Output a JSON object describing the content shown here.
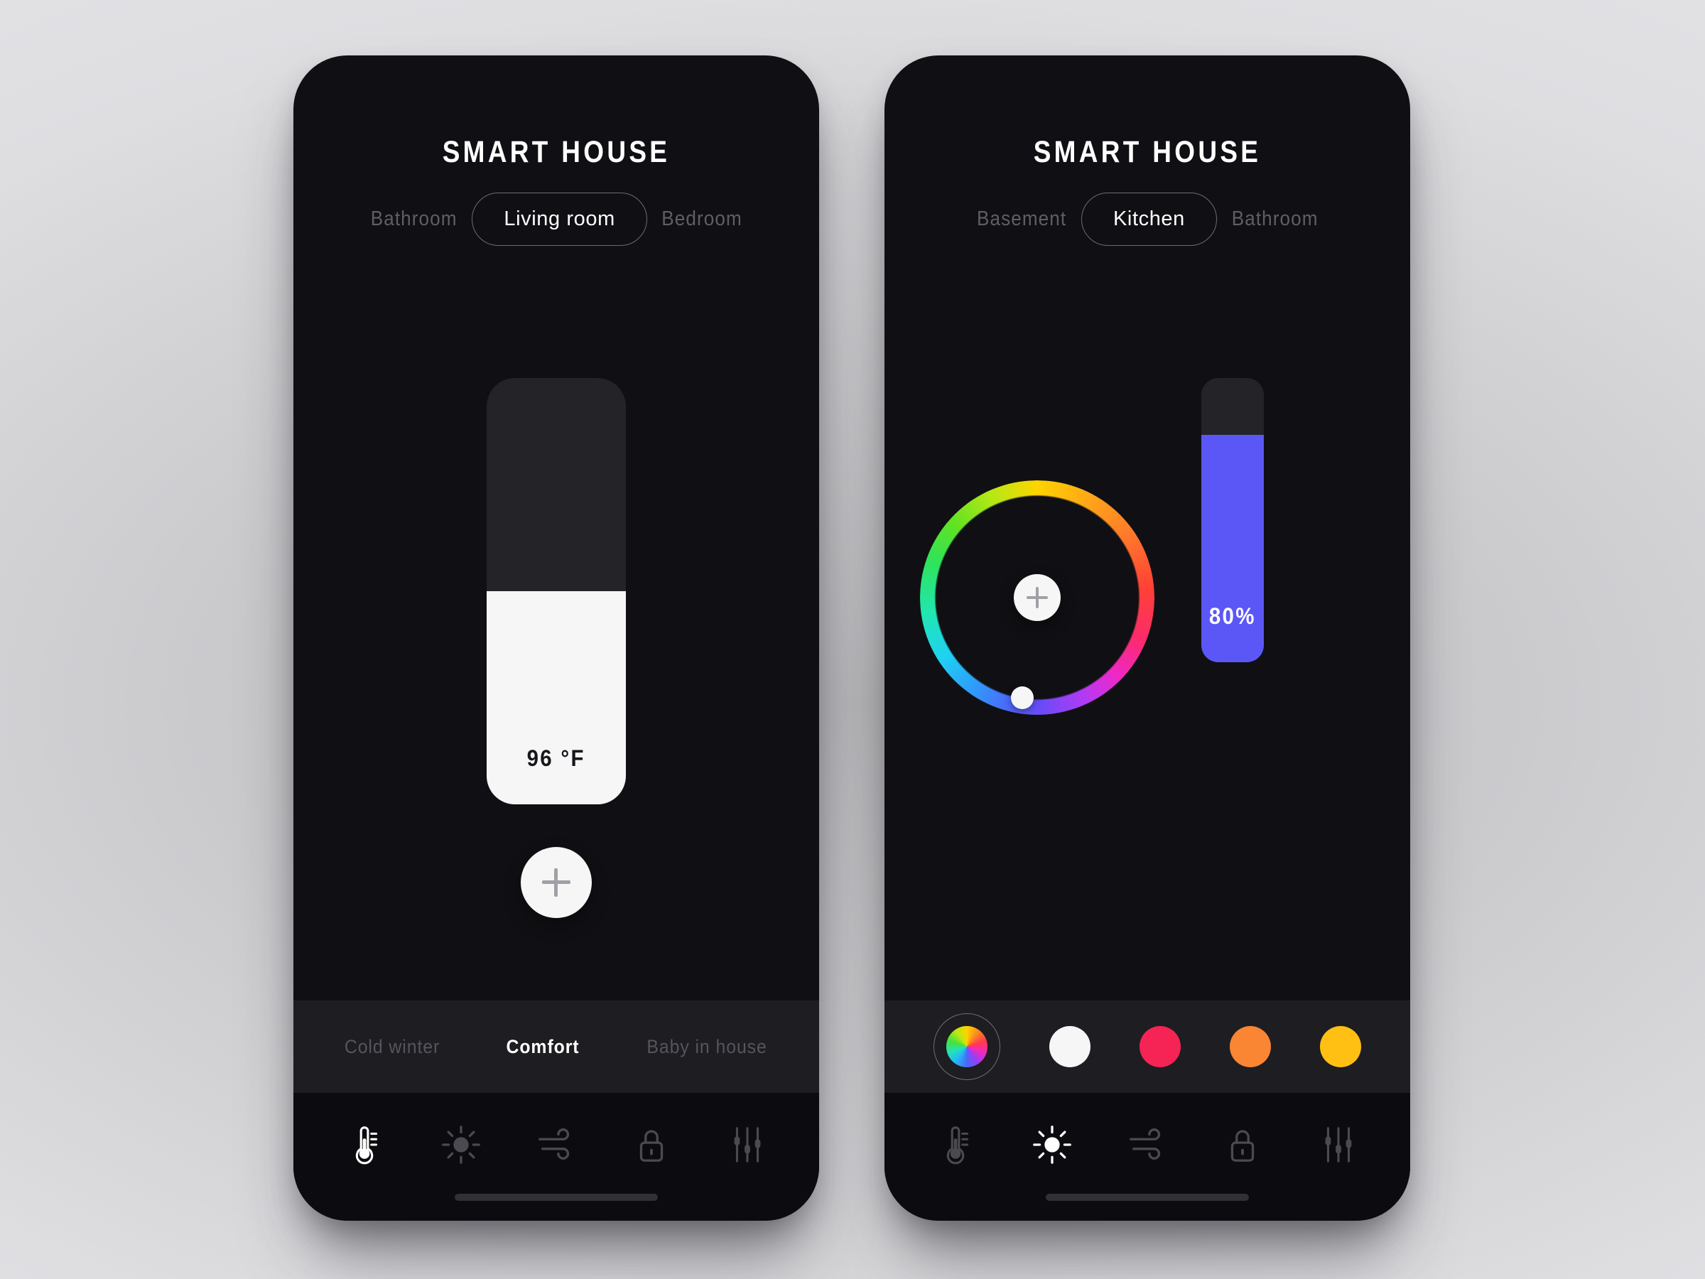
{
  "app": {
    "title": "SMART HOUSE"
  },
  "colors": {
    "screen_bg": "#101014",
    "bar_bg": "#1d1d22",
    "nav_bg": "#0c0c10",
    "slider_track": "#232328",
    "temp_fill": "#f6f6f7",
    "brightness_fill": "#5b57f7",
    "accent_white": "#ffffff",
    "muted_text": "#5e5e66",
    "icon_inactive": "#4a4a51"
  },
  "phones": [
    {
      "id": "thermostat-screen",
      "title": "SMART HOUSE",
      "rooms": [
        {
          "label": "Bathroom",
          "active": false
        },
        {
          "label": "Living room",
          "active": true
        },
        {
          "label": "Bedroom",
          "active": false
        }
      ],
      "slider": {
        "name": "temperature-slider",
        "value_label": "96 °F",
        "value": 96,
        "unit": "°F",
        "fill_percent": 50,
        "fill_color": "#f6f6f7",
        "track_color": "#232328"
      },
      "add_button": {
        "name": "add-device-button",
        "icon": "plus-icon"
      },
      "presets": [
        {
          "label": "Cold winter",
          "active": false
        },
        {
          "label": "Comfort",
          "active": true
        },
        {
          "label": "Baby in house",
          "active": false
        }
      ],
      "nav": [
        {
          "icon": "thermometer-icon",
          "active": true
        },
        {
          "icon": "sun-icon",
          "active": false
        },
        {
          "icon": "wind-icon",
          "active": false
        },
        {
          "icon": "lock-icon",
          "active": false
        },
        {
          "icon": "sliders-icon",
          "active": false
        }
      ]
    },
    {
      "id": "lighting-screen",
      "title": "SMART HOUSE",
      "rooms": [
        {
          "label": "Basement",
          "active": false
        },
        {
          "label": "Kitchen",
          "active": true
        },
        {
          "label": "Bathroom",
          "active": false
        }
      ],
      "color_wheel": {
        "name": "color-wheel",
        "handle_angle_deg": 190,
        "center_button_icon": "plus-icon"
      },
      "slider": {
        "name": "brightness-slider",
        "value_label": "80%",
        "value": 80,
        "unit": "%",
        "fill_percent": 80,
        "fill_color": "#5b57f7",
        "track_color": "#232328"
      },
      "swatches": [
        {
          "name": "swatch-rainbow",
          "color": "rainbow",
          "selected": true
        },
        {
          "name": "swatch-white",
          "color": "#f6f6f7",
          "selected": false
        },
        {
          "name": "swatch-crimson",
          "color": "#f52455",
          "selected": false
        },
        {
          "name": "swatch-orange",
          "color": "#fa8532",
          "selected": false
        },
        {
          "name": "swatch-amber",
          "color": "#ffc013",
          "selected": false
        }
      ],
      "nav": [
        {
          "icon": "thermometer-icon",
          "active": false
        },
        {
          "icon": "sun-icon",
          "active": true
        },
        {
          "icon": "wind-icon",
          "active": false
        },
        {
          "icon": "lock-icon",
          "active": false
        },
        {
          "icon": "sliders-icon",
          "active": false
        }
      ]
    }
  ]
}
